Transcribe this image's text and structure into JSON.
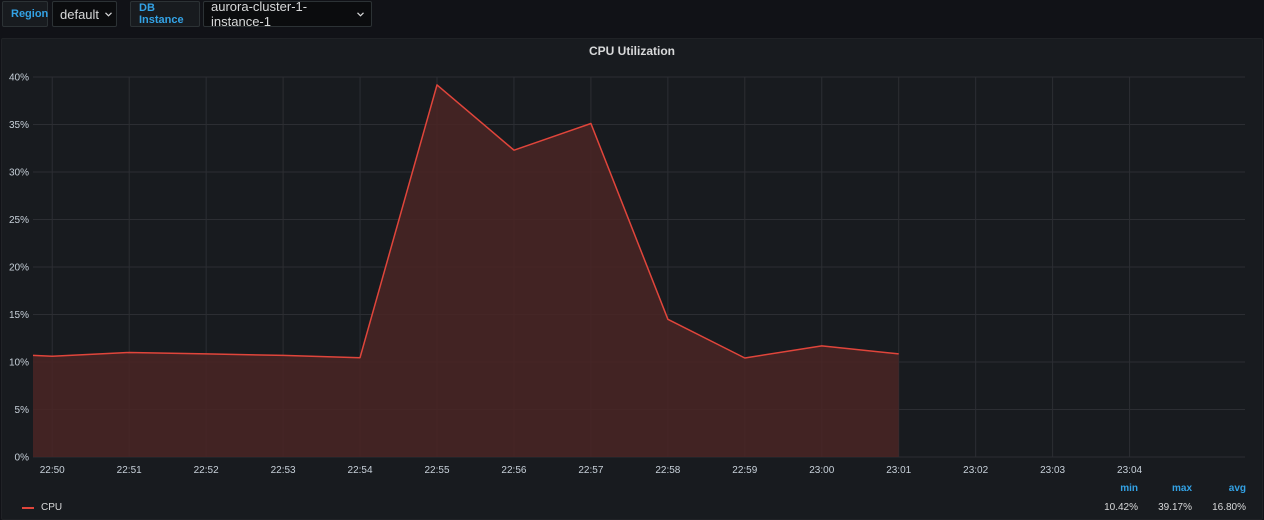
{
  "variables": {
    "region": {
      "label": "Region",
      "value": "default"
    },
    "db_instance": {
      "label": "DB Instance",
      "value": "aurora-cluster-1-instance-1"
    }
  },
  "panel": {
    "title": "CPU Utilization"
  },
  "colors": {
    "series": "#e0453b",
    "fill": "#4a2425",
    "grid": "#2c2e33",
    "legend_header": "#33a2e5"
  },
  "chart_data": {
    "type": "area",
    "title": "CPU Utilization",
    "xlabel": "",
    "ylabel": "",
    "x_ticks": [
      "22:50",
      "22:51",
      "22:52",
      "22:53",
      "22:54",
      "22:55",
      "22:56",
      "22:57",
      "22:58",
      "22:59",
      "23:00",
      "23:01",
      "23:02",
      "23:03",
      "23:04"
    ],
    "y_ticks": [
      "0%",
      "5%",
      "10%",
      "15%",
      "20%",
      "25%",
      "30%",
      "35%",
      "40%"
    ],
    "ylim": [
      0,
      40
    ],
    "xlim": [
      "22:49:45",
      "23:05:30"
    ],
    "grid": true,
    "legend": "bottom-left",
    "series": [
      {
        "name": "CPU",
        "x": [
          "22:49:45",
          "22:50",
          "22:51",
          "22:52",
          "22:53",
          "22:54",
          "22:55",
          "22:56",
          "22:57",
          "22:58",
          "22:59",
          "23:00",
          "23:01"
        ],
        "values": [
          10.7,
          10.6,
          11.0,
          10.85,
          10.7,
          10.45,
          39.17,
          32.3,
          35.1,
          14.5,
          10.42,
          11.7,
          10.85
        ]
      }
    ]
  },
  "legend": {
    "headers": {
      "min": "min",
      "max": "max",
      "avg": "avg"
    },
    "rows": [
      {
        "name": "CPU",
        "min": "10.42%",
        "max": "39.17%",
        "avg": "16.80%"
      }
    ]
  }
}
